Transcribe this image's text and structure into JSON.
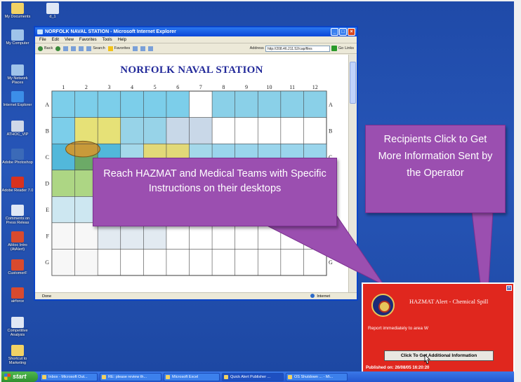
{
  "desktop": {
    "icons": [
      {
        "label": "My Documents",
        "icon": "folder-icon",
        "color": "#f2d264"
      },
      {
        "label": "d_1",
        "icon": "file-icon",
        "color": "#dfe7f5"
      },
      {
        "label": "My Computer",
        "icon": "computer-icon",
        "color": "#9fc3ea"
      },
      {
        "label": "My Network Places",
        "icon": "network-icon",
        "color": "#9fc3ea"
      },
      {
        "label": "Internet Explorer",
        "icon": "ie-icon",
        "color": "#3c8ee8"
      },
      {
        "label": "ATHOC_VIP",
        "icon": "shortcut-icon",
        "color": "#cfd8e8"
      },
      {
        "label": "Adobe Photoshop",
        "icon": "photoshop-icon",
        "color": "#3b6ab8"
      },
      {
        "label": "Adobe Reader 7.0",
        "icon": "reader-icon",
        "color": "#d8311e"
      },
      {
        "label": "Comments on Press Releas",
        "icon": "document-icon",
        "color": "#dfe7f5"
      },
      {
        "label": "AtHoc Intro (AtAlert)",
        "icon": "document-icon",
        "color": "#d84a2e"
      },
      {
        "label": "CustomerF",
        "icon": "document-icon",
        "color": "#d84a2e"
      },
      {
        "label": "airforce",
        "icon": "document-icon",
        "color": "#d84a2e"
      },
      {
        "label": "Competitive Analysis",
        "icon": "document-icon",
        "color": "#dfe7f5"
      },
      {
        "label": "Shortcut to Marketing",
        "icon": "folder-icon",
        "color": "#f2d264"
      }
    ]
  },
  "ie": {
    "title": "NORFOLK NAVAL STATION - Microsoft Internet Explorer",
    "menu": [
      "File",
      "Edit",
      "View",
      "Favorites",
      "Tools",
      "Help"
    ],
    "toolbar": {
      "back": "Back",
      "search": "Search",
      "favorites": "Favorites",
      "address_label": "Address",
      "address_value": "http://208.46.211.52/cap/files",
      "go": "Go",
      "links": "Links"
    },
    "status": {
      "left": "Done",
      "zone": "Internet"
    }
  },
  "map": {
    "title": "NORFOLK NAVAL STATION",
    "cols": [
      "1",
      "2",
      "3",
      "4",
      "5",
      "6",
      "7",
      "8",
      "9",
      "10",
      "11",
      "12"
    ],
    "rows": [
      "A",
      "B",
      "C",
      "D",
      "E",
      "F",
      "G"
    ]
  },
  "callouts": {
    "left": "Reach HAZMAT and Medical Teams with Specific Instructions on their desktops",
    "right": "Recipients Click to Get More Information Sent by the Operator"
  },
  "alert": {
    "title": "HAZMAT Alert - Chemical Spill",
    "message": "Report immediately to area W",
    "button": "Click To Get Additional Information",
    "published": "Published on: 26/08/05 16:20:20"
  },
  "taskbar": {
    "start": "start",
    "tasks": [
      "Inbox - Microsoft Out...",
      "RE: please review th...",
      "Microsoft Excel",
      "Quick Alert Publisher ...",
      "OS Shutdown ... - Mi..."
    ]
  },
  "colors": {
    "callout": "#9b4fb0",
    "alert": "#e0271e",
    "desktop": "#2756b8"
  }
}
